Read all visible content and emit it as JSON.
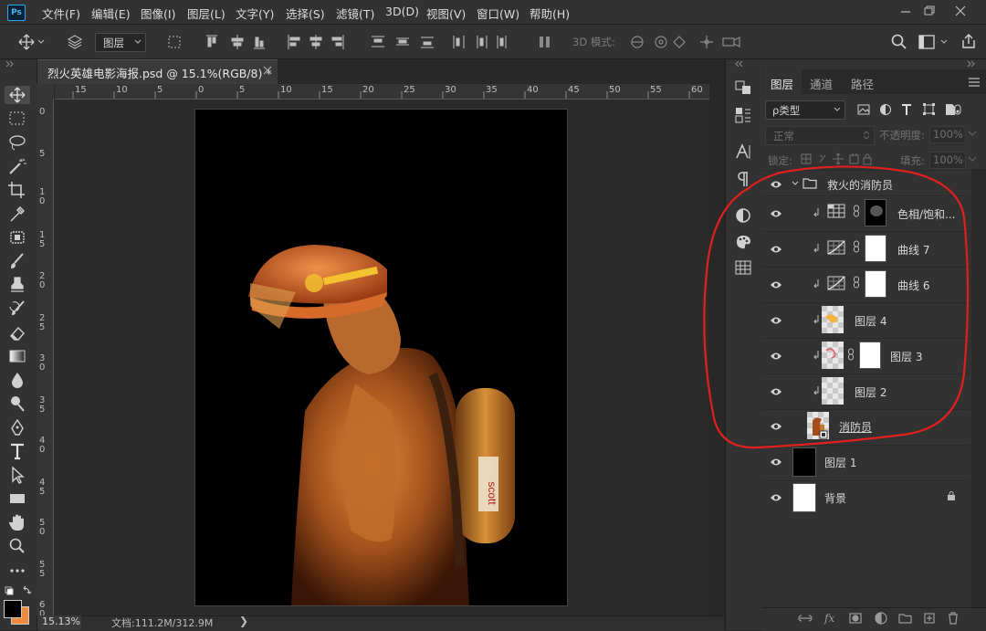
{
  "app": {
    "logo_text": "Ps"
  },
  "menu": [
    "文件(F)",
    "编辑(E)",
    "图像(I)",
    "图层(L)",
    "文字(Y)",
    "选择(S)",
    "滤镜(T)",
    "3D(D)",
    "视图(V)",
    "窗口(W)",
    "帮助(H)"
  ],
  "options_bar": {
    "auto_select_value": "图层",
    "mode_3d_label": "3D 模式:"
  },
  "document": {
    "tab_title": "烈火英雄电影海报.psd @ 15.1%(RGB/8) *",
    "ruler_top": [
      "15",
      "10",
      "5",
      "0",
      "5",
      "10",
      "15",
      "20",
      "25",
      "30",
      "35",
      "40",
      "45",
      "50",
      "55",
      "60"
    ],
    "ruler_left": [
      "0",
      "5",
      "1\n0",
      "1\n5",
      "2\n0",
      "2\n5",
      "3\n0",
      "3\n5",
      "4\n0",
      "4\n5",
      "5\n0",
      "5\n5",
      "6\n0"
    ],
    "zoom": "15.13%",
    "doc_info": "文档:111.2M/312.9M",
    "status_arrow": "❯"
  },
  "layers_panel": {
    "tabs": [
      "图层",
      "通道",
      "路径"
    ],
    "filter_label": "ρ类型",
    "blend_mode": "正常",
    "opacity_label": "不透明度:",
    "opacity_value": "100%",
    "lock_label": "锁定:",
    "fill_label": "填充:",
    "fill_value": "100%",
    "layers": [
      {
        "name": "救火的消防员",
        "type": "group"
      },
      {
        "name": "色相/饱和...",
        "type": "adjustment-hue"
      },
      {
        "name": "曲线 7",
        "type": "adjustment-curves"
      },
      {
        "name": "曲线 6",
        "type": "adjustment-curves"
      },
      {
        "name": "图层 4",
        "type": "pixel"
      },
      {
        "name": "图层 3",
        "type": "pixel-mask"
      },
      {
        "name": "图层 2",
        "type": "pixel"
      },
      {
        "name": "消防员",
        "type": "smart-object"
      },
      {
        "name": "图层 1",
        "type": "fill-black"
      },
      {
        "name": "背景",
        "type": "background-locked"
      }
    ]
  },
  "colors": {
    "annotation_red": "#e0201e",
    "foreground": "#000000",
    "background_swatch": "#f08a3c"
  }
}
